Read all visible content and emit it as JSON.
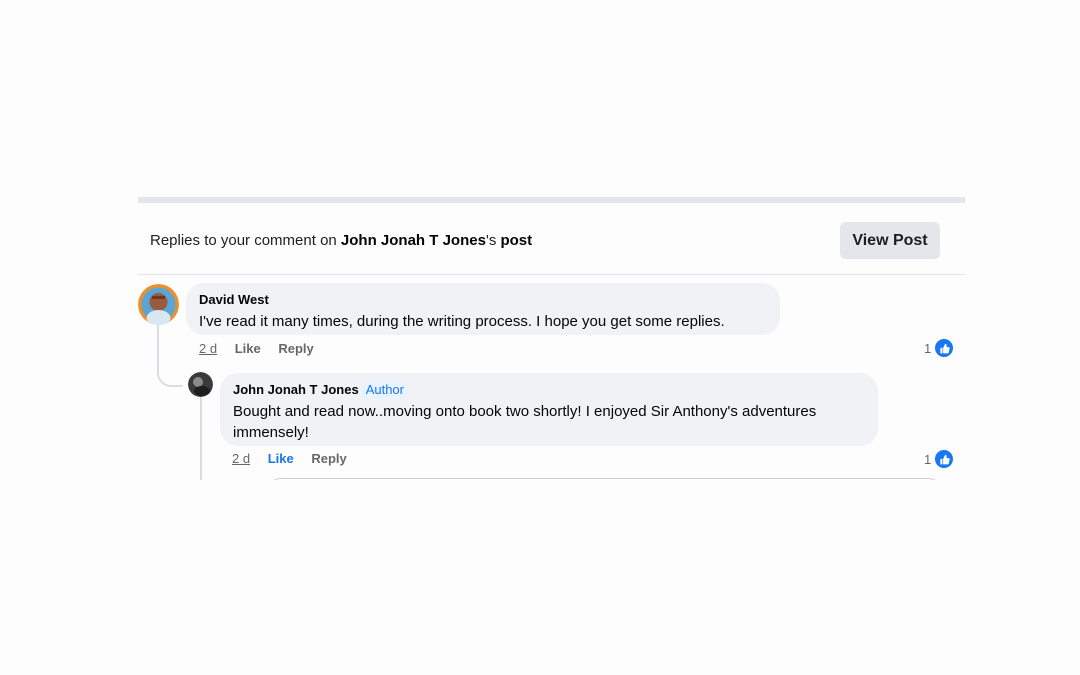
{
  "notification": {
    "header_prefix": "Replies to your comment on ",
    "header_author": "John Jonah T Jones",
    "header_middle": "'s ",
    "header_suffix": "post",
    "view_post_label": "View Post"
  },
  "comments": [
    {
      "author": "David West",
      "text": "I've read it many times, during the writing process. I hope you get some replies.",
      "time": "2 d",
      "like_label": "Like",
      "reply_label": "Reply",
      "reaction_count": "1",
      "liked": false
    },
    {
      "author": "John Jonah T Jones",
      "badge": "Author",
      "text": "Bought and read now..moving onto book two shortly! I enjoyed Sir Anthony's adventures immensely!",
      "time": "2 d",
      "like_label": "Like",
      "reply_label": "Reply",
      "reaction_count": "1",
      "liked": true
    }
  ],
  "colors": {
    "accent": "#1877f2",
    "bubble": "#f0f2f5",
    "button": "#e4e6eb"
  },
  "icons": [
    "avatar-photo",
    "thumbs-up-icon"
  ]
}
